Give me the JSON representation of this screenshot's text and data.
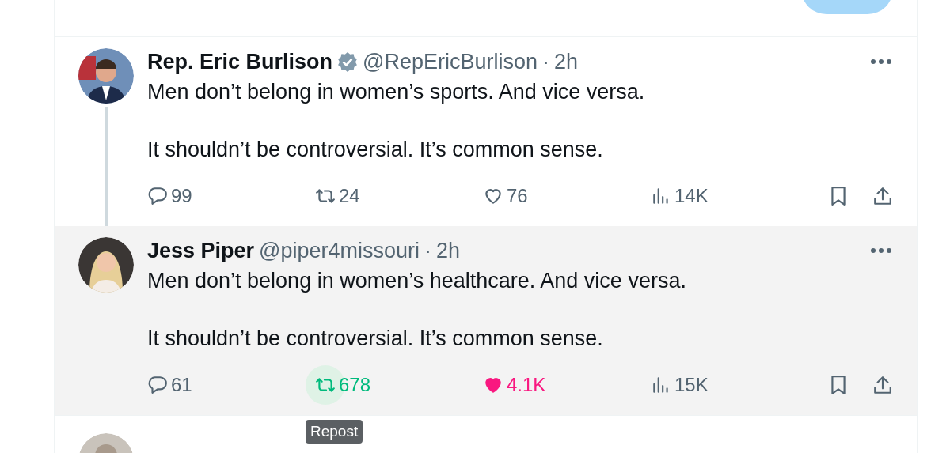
{
  "compose": {
    "reply_button": {
      "disabled": true
    }
  },
  "tweets": [
    {
      "author": "Rep. Eric Burlison",
      "verified": true,
      "handle": "@RepEricBurlison",
      "separator": "·",
      "time": "2h",
      "thread": true,
      "shaded": false,
      "paragraphs": [
        "Men don’t belong in women’s sports. And vice versa.",
        "It shouldn’t be controversial. It’s common sense."
      ],
      "actions": [
        {
          "kind": "reply",
          "count": "99",
          "hovered": false
        },
        {
          "kind": "repost",
          "count": "24",
          "active": false,
          "hovered": false
        },
        {
          "kind": "like",
          "count": "76",
          "active": false,
          "hovered": false
        },
        {
          "kind": "views",
          "count": "14K",
          "hovered": false
        }
      ]
    },
    {
      "author": "Jess Piper",
      "verified": false,
      "handle": "@piper4missouri",
      "separator": "·",
      "time": "2h",
      "thread": false,
      "shaded": true,
      "paragraphs": [
        "Men don’t belong in women’s healthcare. And vice versa.",
        "It shouldn’t be controversial. It’s common sense."
      ],
      "actions": [
        {
          "kind": "reply",
          "count": "61",
          "hovered": false
        },
        {
          "kind": "repost",
          "count": "678",
          "active": false,
          "hovered": true,
          "tooltip": "Repost"
        },
        {
          "kind": "like",
          "count": "4.1K",
          "active": true,
          "hovered": false
        },
        {
          "kind": "views",
          "count": "15K",
          "hovered": false
        }
      ]
    }
  ]
}
